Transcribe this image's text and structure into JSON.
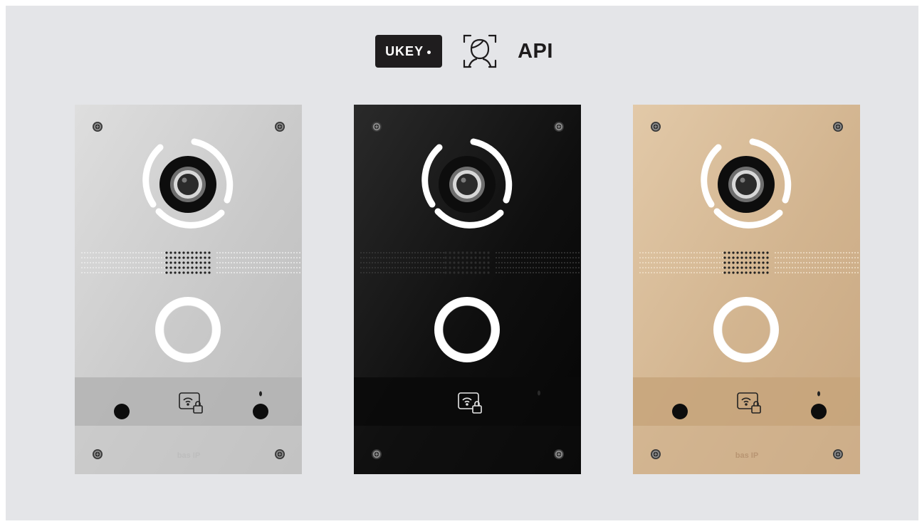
{
  "header": {
    "ukey_label": "UKEY",
    "face_icon": "face-recognition-icon",
    "api_label": "API"
  },
  "panels": [
    {
      "finish": "silver",
      "base": "#c9c9c9",
      "light": "#dedede",
      "dark": "#bcbcbc",
      "strip": "#b3b3b3",
      "logo": "bas IP"
    },
    {
      "finish": "black",
      "base": "#0f0f0f",
      "light": "#2a2a2a",
      "dark": "#050505",
      "strip": "#0a0a0a",
      "logo": ""
    },
    {
      "finish": "gold",
      "base": "#d2b48f",
      "light": "#e2c9a8",
      "dark": "#c9a882",
      "strip": "#c7a47b",
      "logo": "bas IP"
    }
  ],
  "colors": {
    "background": "#e4e5e8",
    "badge": "#1f1d1e",
    "led": "#ffffff"
  }
}
